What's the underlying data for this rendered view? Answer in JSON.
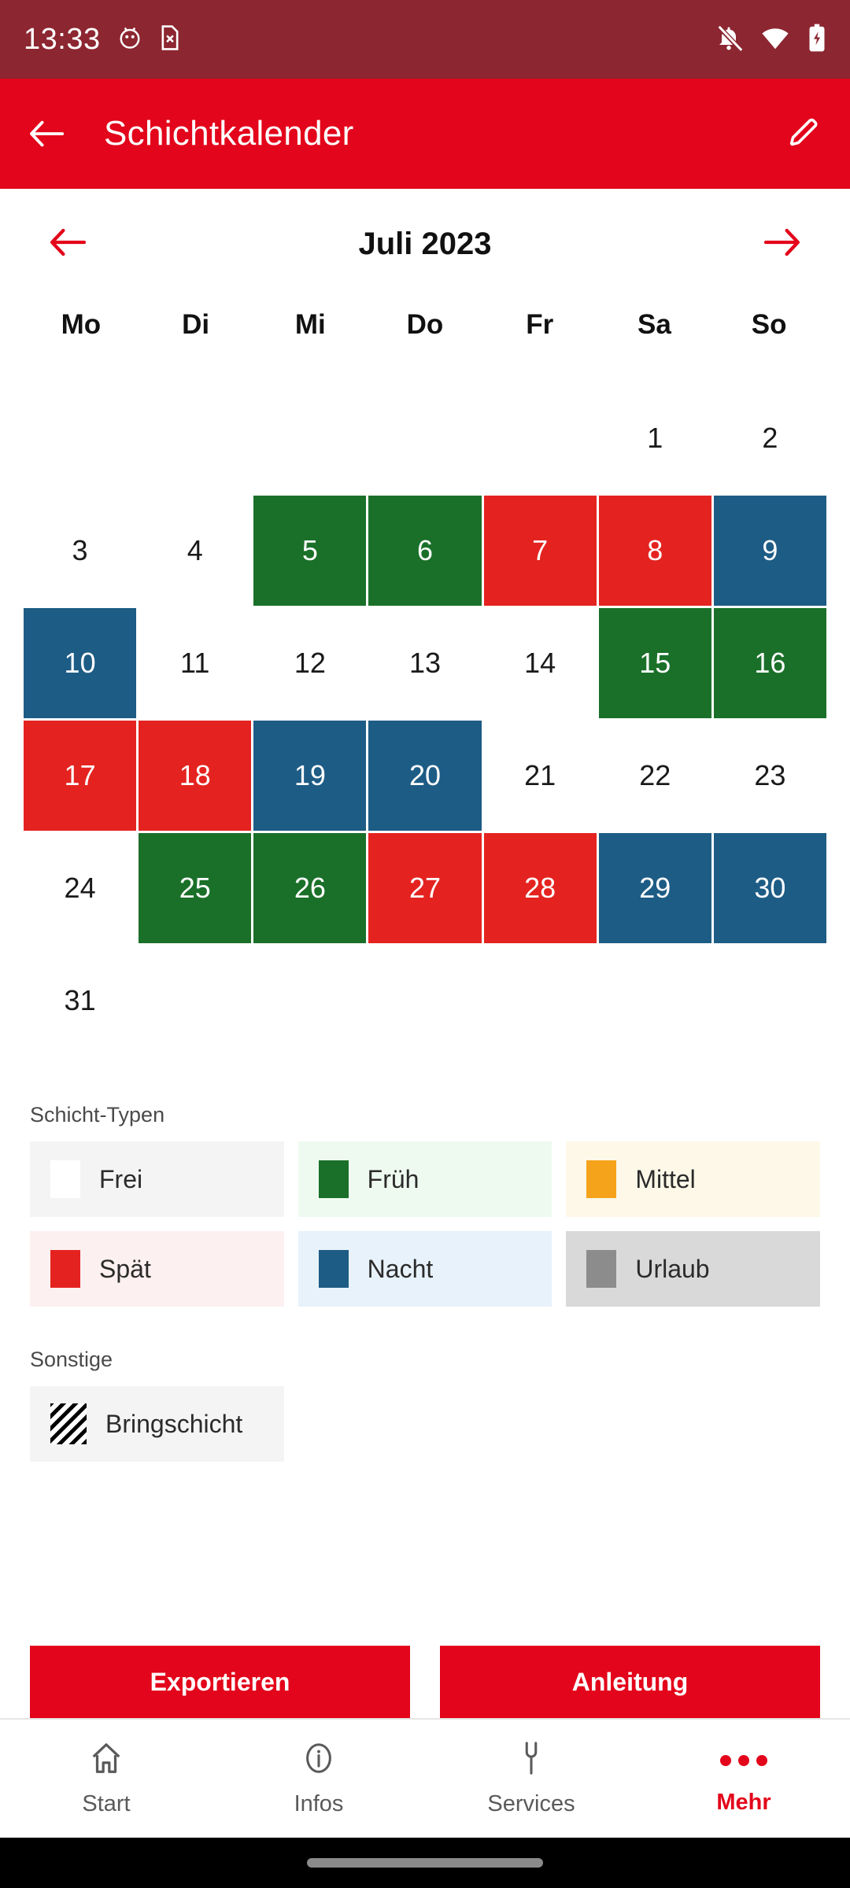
{
  "status_bar": {
    "time": "13:33",
    "left_icons": [
      "android-debug-icon",
      "sim-card-error-icon"
    ],
    "right_icons": [
      "notifications-off-icon",
      "wifi-icon",
      "battery-charging-icon"
    ],
    "background_color": "#8c2630"
  },
  "app_bar": {
    "back_label": "back-arrow",
    "title": "Schichtkalender",
    "edit_label": "edit-pencil",
    "background_color": "#e3051b"
  },
  "calendar": {
    "prev_label": "previous-month",
    "next_label": "next-month",
    "month_label": "Juli 2023",
    "weekdays": [
      "Mo",
      "Di",
      "Mi",
      "Do",
      "Fr",
      "Sa",
      "So"
    ],
    "leading_blanks": 5,
    "days": [
      {
        "num": "1",
        "shift": "frei"
      },
      {
        "num": "2",
        "shift": "frei"
      },
      {
        "num": "3",
        "shift": "frei"
      },
      {
        "num": "4",
        "shift": "frei"
      },
      {
        "num": "5",
        "shift": "frueh"
      },
      {
        "num": "6",
        "shift": "frueh"
      },
      {
        "num": "7",
        "shift": "spaet"
      },
      {
        "num": "8",
        "shift": "spaet"
      },
      {
        "num": "9",
        "shift": "nacht"
      },
      {
        "num": "10",
        "shift": "nacht"
      },
      {
        "num": "11",
        "shift": "frei"
      },
      {
        "num": "12",
        "shift": "frei"
      },
      {
        "num": "13",
        "shift": "frei"
      },
      {
        "num": "14",
        "shift": "frei"
      },
      {
        "num": "15",
        "shift": "frueh"
      },
      {
        "num": "16",
        "shift": "frueh"
      },
      {
        "num": "17",
        "shift": "spaet"
      },
      {
        "num": "18",
        "shift": "spaet"
      },
      {
        "num": "19",
        "shift": "nacht"
      },
      {
        "num": "20",
        "shift": "nacht"
      },
      {
        "num": "21",
        "shift": "frei"
      },
      {
        "num": "22",
        "shift": "frei"
      },
      {
        "num": "23",
        "shift": "frei"
      },
      {
        "num": "24",
        "shift": "frei"
      },
      {
        "num": "25",
        "shift": "frueh"
      },
      {
        "num": "26",
        "shift": "frueh"
      },
      {
        "num": "27",
        "shift": "spaet"
      },
      {
        "num": "28",
        "shift": "spaet"
      },
      {
        "num": "29",
        "shift": "nacht"
      },
      {
        "num": "30",
        "shift": "nacht"
      },
      {
        "num": "31",
        "shift": "frei"
      }
    ],
    "shift_colors": {
      "frei": "transparent",
      "frueh": "#1a7029",
      "spaet": "#e42320",
      "nacht": "#1d5c85",
      "mittel": "#f5a31a",
      "urlaub": "#8c8c8c"
    }
  },
  "legend": {
    "title": "Schicht-Typen",
    "items": [
      {
        "label": "Frei",
        "swatch_color": "#ffffff",
        "chip_bg": "#f4f4f4"
      },
      {
        "label": "Früh",
        "swatch_color": "#1a7029",
        "chip_bg": "#eefaf0"
      },
      {
        "label": "Mittel",
        "swatch_color": "#f5a31a",
        "chip_bg": "#fdf8e8"
      },
      {
        "label": "Spät",
        "swatch_color": "#e42320",
        "chip_bg": "#fdf0f0"
      },
      {
        "label": "Nacht",
        "swatch_color": "#1d5c85",
        "chip_bg": "#e8f2fb"
      },
      {
        "label": "Urlaub",
        "swatch_color": "#8c8c8c",
        "chip_bg": "#d9d9d9"
      }
    ]
  },
  "sonstige": {
    "title": "Sonstige",
    "items": [
      {
        "label": "Bringschicht",
        "swatch_pattern": "diagonal-hatch",
        "chip_bg": "#f4f4f4"
      }
    ]
  },
  "actions": {
    "export_label": "Exportieren",
    "guide_label": "Anleitung",
    "button_color": "#e3051b"
  },
  "bottom_nav": {
    "items": [
      {
        "label": "Start",
        "icon": "home-icon",
        "active": false
      },
      {
        "label": "Infos",
        "icon": "info-icon",
        "active": false
      },
      {
        "label": "Services",
        "icon": "wrench-icon",
        "active": false
      },
      {
        "label": "Mehr",
        "icon": "more-dots-icon",
        "active": true
      }
    ],
    "active_color": "#e3051b"
  }
}
